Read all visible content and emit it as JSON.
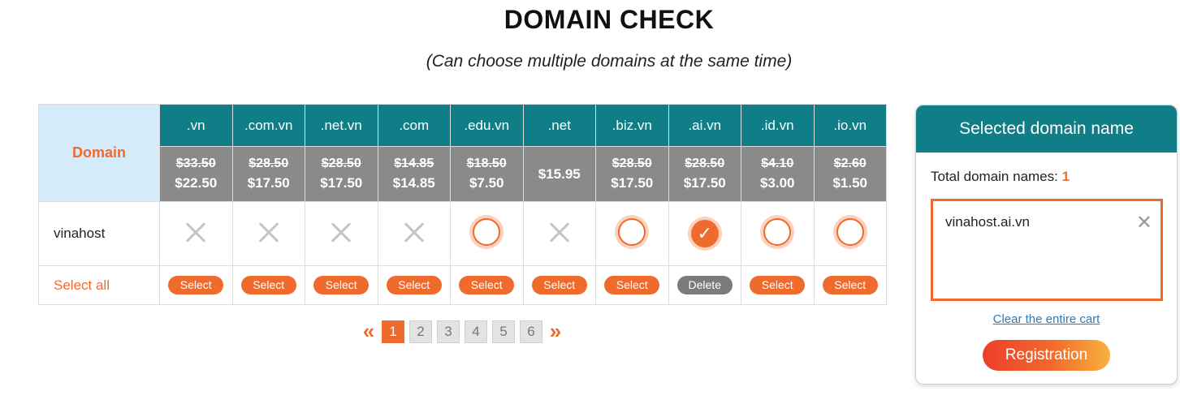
{
  "header": {
    "title": "DOMAIN CHECK",
    "subtitle": "(Can choose multiple domains at the same time)"
  },
  "table": {
    "domain_label": "Domain",
    "extensions": [
      {
        "tld": ".vn",
        "old_price": "$33.50",
        "price": "$22.50",
        "status": "unavailable",
        "action": "Select"
      },
      {
        "tld": ".com.vn",
        "old_price": "$28.50",
        "price": "$17.50",
        "status": "unavailable",
        "action": "Select"
      },
      {
        "tld": ".net.vn",
        "old_price": "$28.50",
        "price": "$17.50",
        "status": "unavailable",
        "action": "Select"
      },
      {
        "tld": ".com",
        "old_price": "$14.85",
        "price": "$14.85",
        "status": "unavailable",
        "action": "Select"
      },
      {
        "tld": ".edu.vn",
        "old_price": "$18.50",
        "price": "$7.50",
        "status": "available",
        "action": "Select"
      },
      {
        "tld": ".net",
        "old_price": "",
        "price": "$15.95",
        "status": "unavailable",
        "action": "Select"
      },
      {
        "tld": ".biz.vn",
        "old_price": "$28.50",
        "price": "$17.50",
        "status": "available",
        "action": "Select"
      },
      {
        "tld": ".ai.vn",
        "old_price": "$28.50",
        "price": "$17.50",
        "status": "selected",
        "action": "Delete"
      },
      {
        "tld": ".id.vn",
        "old_price": "$4.10",
        "price": "$3.00",
        "status": "available",
        "action": "Select"
      },
      {
        "tld": ".io.vn",
        "old_price": "$2.60",
        "price": "$1.50",
        "status": "available",
        "action": "Select"
      }
    ],
    "row_name": "vinahost",
    "select_all_label": "Select all"
  },
  "pagination": {
    "prev": "«",
    "next": "»",
    "pages": [
      "1",
      "2",
      "3",
      "4",
      "5",
      "6"
    ],
    "current": "1"
  },
  "cart": {
    "title": "Selected domain name",
    "total_label": "Total domain names: ",
    "total_count": "1",
    "items": [
      "vinahost.ai.vn"
    ],
    "remove_glyph": "✕",
    "clear_label": "Clear the entire cart",
    "register_label": "Registration"
  },
  "icons": {
    "unavailable": "x-icon",
    "available": "radio-icon",
    "selected": "check-icon",
    "remove": "close-icon"
  },
  "colors": {
    "accent": "#ef6a2d",
    "teal": "#0f7e86",
    "price_bg": "#8a8a8a",
    "domain_head_bg": "#d6ebfa"
  }
}
